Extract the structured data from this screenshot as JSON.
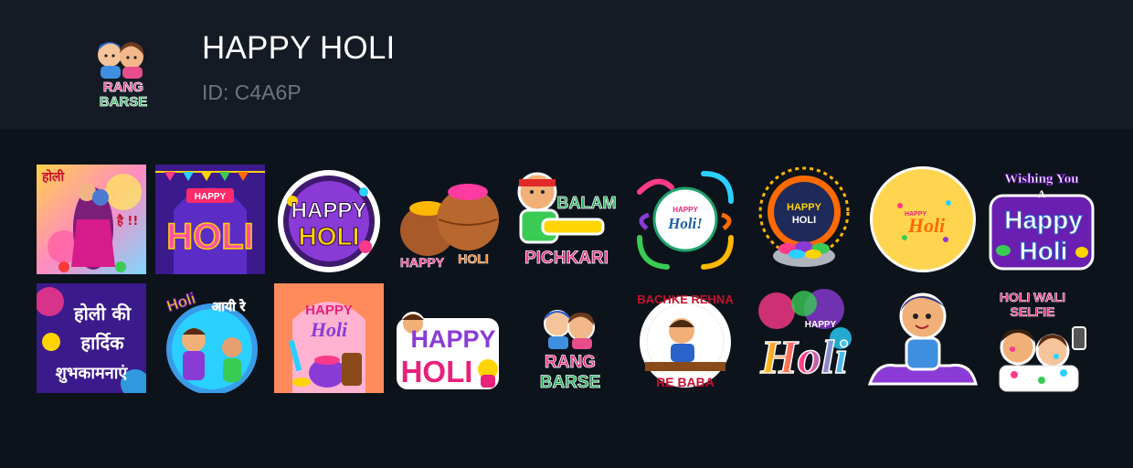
{
  "pack": {
    "title": "HAPPY HOLI",
    "id_text": "ID: C4A6P",
    "logo_text_line1": "RANG",
    "logo_text_line2": "BARSE"
  },
  "stickers": [
    {
      "name": "sticker-holi-hai-couple",
      "text1": "होली",
      "text2": "है !!"
    },
    {
      "name": "sticker-happy-holi-gate",
      "text1": "HAPPY",
      "text2": "HOLI"
    },
    {
      "name": "sticker-happy-holi-badge",
      "text1": "HAPPY",
      "text2": "HOLI"
    },
    {
      "name": "sticker-happy-holi-pots",
      "text1": "HAPPY",
      "text2": "HOLI"
    },
    {
      "name": "sticker-balam-pichkari",
      "text1": "BALAM",
      "text2": "PICHKARI"
    },
    {
      "name": "sticker-happy-holi-swirl",
      "text1": "HAPPY",
      "text2": "Holi!"
    },
    {
      "name": "sticker-happy-holi-mandala",
      "text1": "HAPPY",
      "text2": "HOLI"
    },
    {
      "name": "sticker-happy-holi-yellow-circle",
      "text1": "HAPPY",
      "text2": "Holi"
    },
    {
      "name": "sticker-wishing-you-happy-holi",
      "text1": "Wishing You",
      "text2": "A",
      "text3": "Happy",
      "text4": "Holi"
    },
    {
      "name": "sticker-holi-ki-hardik",
      "text1": "होली की",
      "text2": "हार्दिक",
      "text3": "शुभकामनाएं"
    },
    {
      "name": "sticker-holi-aayi-re",
      "text1": "Holi",
      "text2": "आयी रे"
    },
    {
      "name": "sticker-happy-holi-drums",
      "text1": "HAPPY",
      "text2": "Holi"
    },
    {
      "name": "sticker-happy-holi-pink",
      "text1": "HAPPY",
      "text2": "HOLI"
    },
    {
      "name": "sticker-rang-barse",
      "text1": "RANG",
      "text2": "BARSE"
    },
    {
      "name": "sticker-bachke-rehna",
      "text1": "BACHKE REHNA",
      "text2": "RE BABA"
    },
    {
      "name": "sticker-happy-holi-splash",
      "text1": "HAPPY",
      "text2": "Holi"
    },
    {
      "name": "sticker-boy-carpet",
      "text1": ""
    },
    {
      "name": "sticker-holi-wali-selfie",
      "text1": "HOLI WALI",
      "text2": "SELFIE"
    }
  ]
}
